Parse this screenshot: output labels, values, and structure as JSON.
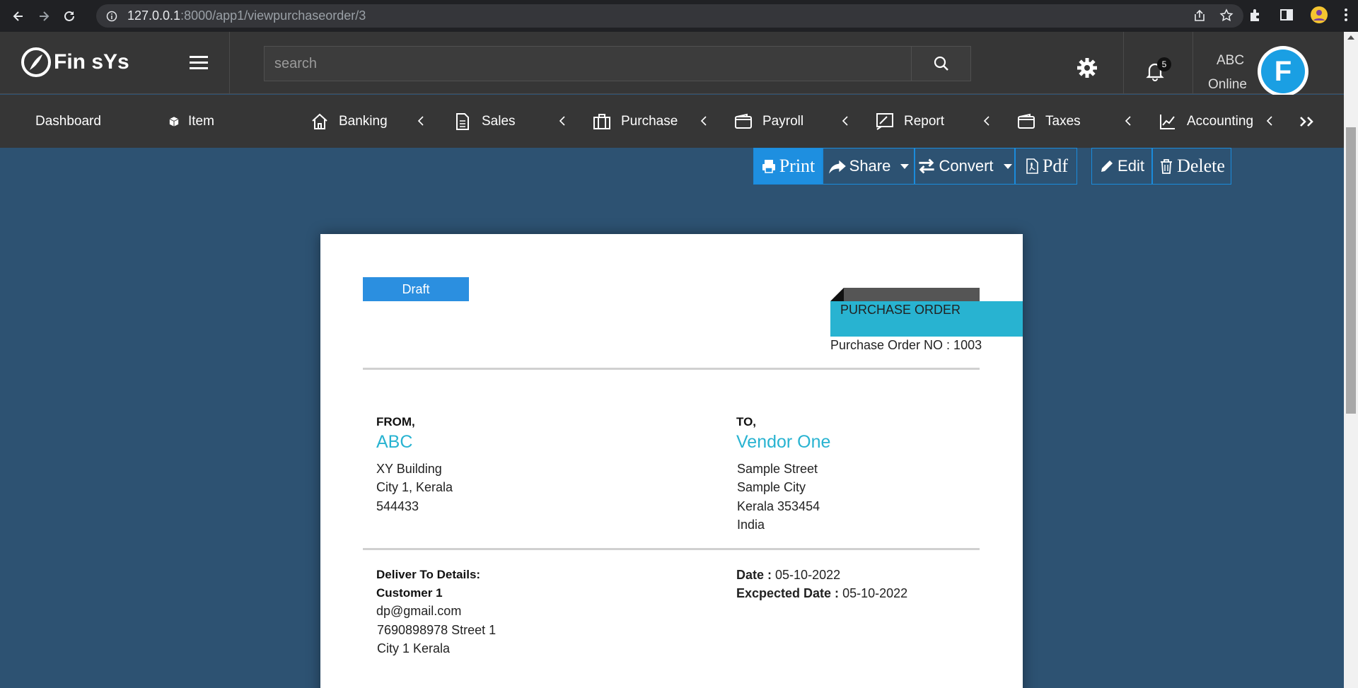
{
  "browser": {
    "url_host": "127.0.0.1",
    "url_path": ":8000/app1/viewpurchaseorder/3"
  },
  "header": {
    "brand": "Fin sYs",
    "search_placeholder": "search",
    "notifications_count": "5",
    "user_name": "ABC",
    "user_status": "Online",
    "avatar_letter": "F"
  },
  "menu": {
    "dashboard": "Dashboard",
    "item": "Item",
    "banking": "Banking",
    "sales": "Sales",
    "purchase": "Purchase",
    "payroll": "Payroll",
    "report": "Report",
    "taxes": "Taxes",
    "accounting": "Accounting"
  },
  "actions": {
    "print": "Print",
    "share": "Share",
    "convert": "Convert",
    "pdf": "Pdf",
    "edit": "Edit",
    "delete": "Delete"
  },
  "document": {
    "status": "Draft",
    "title": "PURCHASE ORDER",
    "number_label": "Purchase Order NO : 1003",
    "from_label": "FROM,",
    "from_name": "ABC",
    "from_address": [
      "XY Building",
      "City 1, Kerala",
      "544433"
    ],
    "to_label": "TO,",
    "to_name": "Vendor One",
    "to_address": [
      "Sample Street",
      "Sample City",
      "Kerala 353454",
      "India"
    ],
    "deliver_label": "Deliver To Details:",
    "deliver_customer": "Customer 1",
    "deliver_lines": [
      "dp@gmail.com",
      "7690898978 Street 1",
      "City 1 Kerala"
    ],
    "date_label": "Date :",
    "date_value": "05-10-2022",
    "expected_label": "Excpected Date :",
    "expected_value": "05-10-2022"
  },
  "colors": {
    "accent": "#1e8fe0",
    "teal": "#28b3d1",
    "page_bg": "#2d5272",
    "header_bg": "#363636"
  }
}
